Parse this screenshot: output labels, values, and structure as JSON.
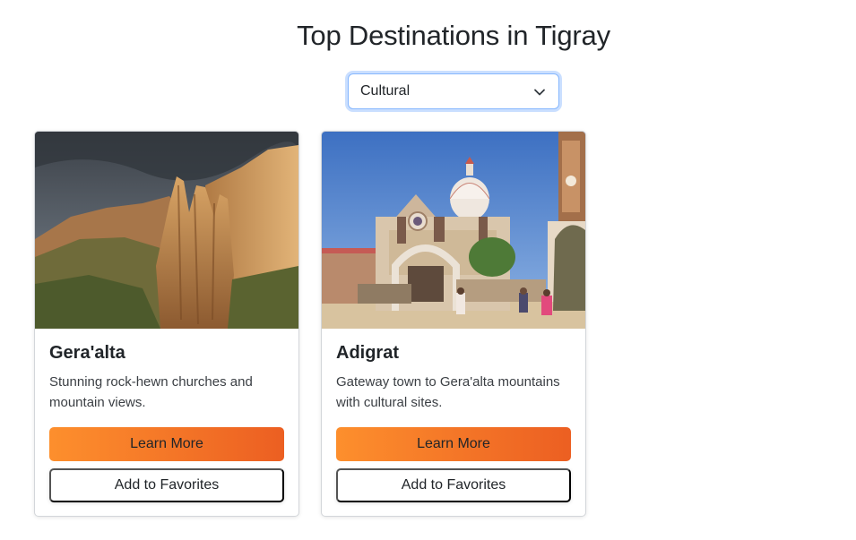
{
  "page": {
    "title": "Top Destinations in Tigray"
  },
  "filter": {
    "selected": "Cultural",
    "icon": "chevron-down-icon"
  },
  "colors": {
    "focus_ring": "#86b7fe",
    "learn_gradient_start": "#fd8f2d",
    "learn_gradient_end": "#ec5f22"
  },
  "cards": [
    {
      "title": "Gera'alta",
      "description": "Stunning rock-hewn churches and mountain views.",
      "learn_more": "Learn More",
      "favorites": "Add to Favorites"
    },
    {
      "title": "Adigrat",
      "description": "Gateway town to Gera'alta mountains with cultural sites.",
      "learn_more": "Learn More",
      "favorites": "Add to Favorites"
    }
  ]
}
